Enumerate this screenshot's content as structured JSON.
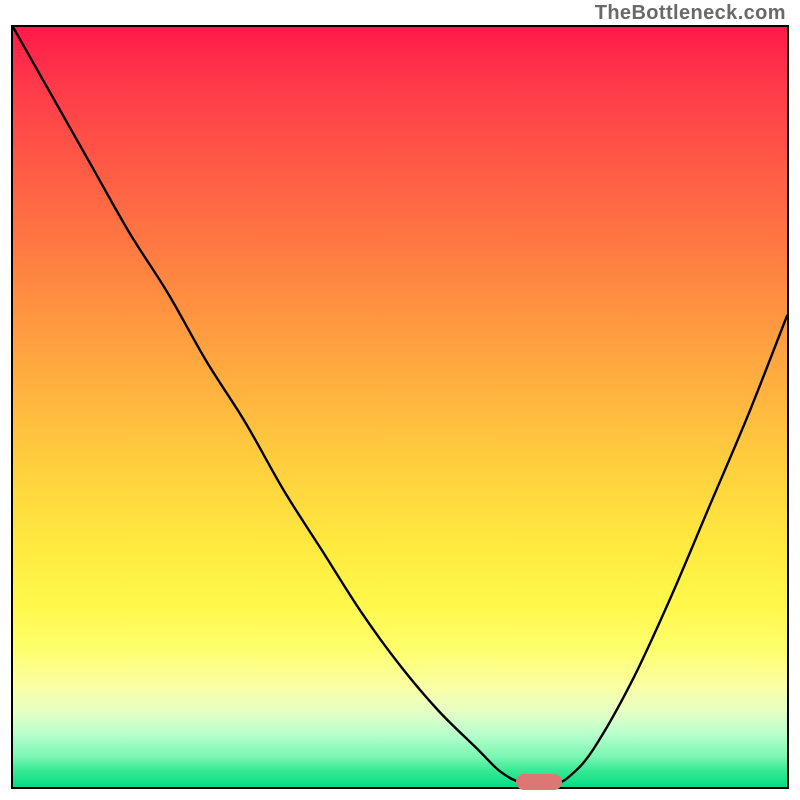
{
  "watermark": {
    "text": "TheBottleneck.com"
  },
  "colors": {
    "curve_stroke": "#000000",
    "marker_fill": "#de7674",
    "plot_border": "#000000"
  },
  "chart_data": {
    "type": "line",
    "title": "",
    "xlabel": "",
    "ylabel": "",
    "xlim": [
      0,
      100
    ],
    "ylim": [
      0,
      100
    ],
    "grid": false,
    "legend": false,
    "series": [
      {
        "name": "bottleneck-curve",
        "x": [
          0,
          5,
          10,
          15,
          20,
          25,
          30,
          35,
          40,
          45,
          50,
          55,
          60,
          63,
          66,
          70,
          72,
          75,
          80,
          85,
          90,
          95,
          100
        ],
        "y": [
          100,
          91,
          82,
          73,
          65,
          56,
          48,
          39,
          31,
          23,
          16,
          10,
          5,
          2,
          0.5,
          0.5,
          1.5,
          5,
          14,
          25,
          37,
          49,
          62
        ]
      }
    ],
    "marker": {
      "name": "optimal-point",
      "x": 68,
      "y": 0.6
    },
    "gradient_stops": [
      {
        "pos": 0.0,
        "color": "#ff1a4a"
      },
      {
        "pos": 0.18,
        "color": "#ff5946"
      },
      {
        "pos": 0.38,
        "color": "#ff9540"
      },
      {
        "pos": 0.58,
        "color": "#ffd03e"
      },
      {
        "pos": 0.76,
        "color": "#fff84a"
      },
      {
        "pos": 0.9,
        "color": "#e6ffc4"
      },
      {
        "pos": 1.0,
        "color": "#05dd86"
      }
    ]
  }
}
